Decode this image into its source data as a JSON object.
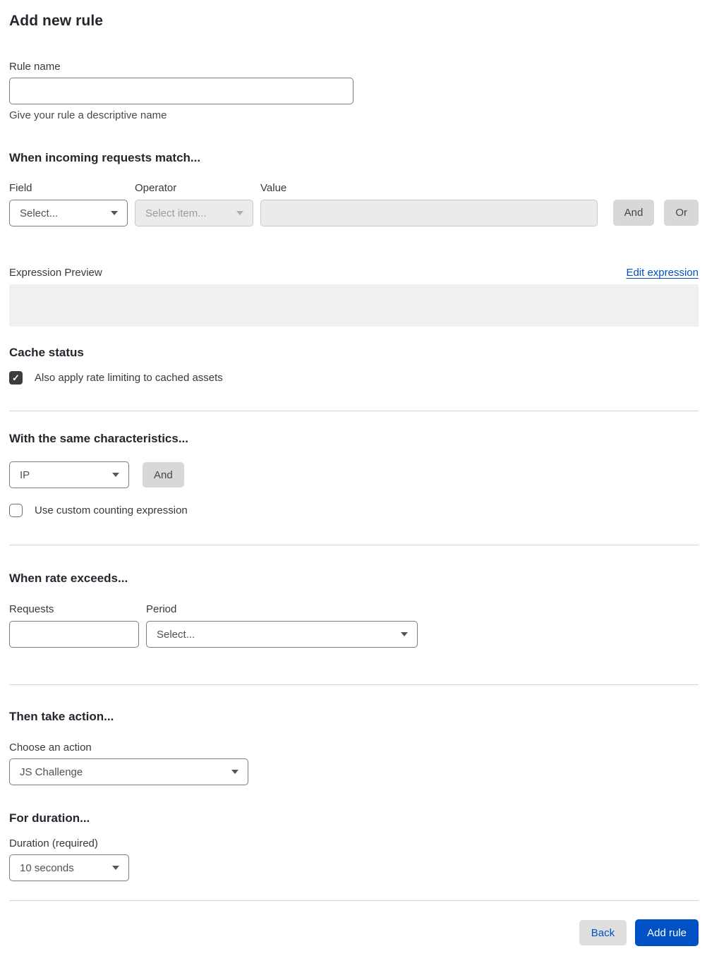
{
  "title": "Add new rule",
  "rule_name": {
    "label": "Rule name",
    "value": "",
    "helper": "Give your rule a descriptive name"
  },
  "match": {
    "heading": "When incoming requests match...",
    "field": {
      "label": "Field",
      "selected": "Select..."
    },
    "operator": {
      "label": "Operator",
      "selected": "Select item..."
    },
    "value": {
      "label": "Value",
      "value": ""
    },
    "and_label": "And",
    "or_label": "Or"
  },
  "expression": {
    "label": "Expression Preview",
    "edit_link": "Edit expression",
    "preview_text": ""
  },
  "cache": {
    "heading": "Cache status",
    "checkbox_label": "Also apply rate limiting to cached assets",
    "checked": true
  },
  "characteristics": {
    "heading": "With the same characteristics...",
    "selected": "IP",
    "and_label": "And",
    "checkbox_label": "Use custom counting expression",
    "checked": false
  },
  "rate": {
    "heading": "When rate exceeds...",
    "requests_label": "Requests",
    "requests_value": "",
    "period_label": "Period",
    "period_selected": "Select..."
  },
  "action": {
    "heading": "Then take action...",
    "label": "Choose an action",
    "selected": "JS Challenge"
  },
  "duration": {
    "heading": "For duration...",
    "label": "Duration (required)",
    "selected": "10 seconds"
  },
  "footer": {
    "back_label": "Back",
    "submit_label": "Add rule"
  },
  "icons": {
    "check": "✓"
  },
  "colors": {
    "accent_blue": "#0051c3",
    "checkbox_dark": "#3d3d3d",
    "disabled_gray": "#ebebeb",
    "button_gray": "#d8d8d8"
  }
}
